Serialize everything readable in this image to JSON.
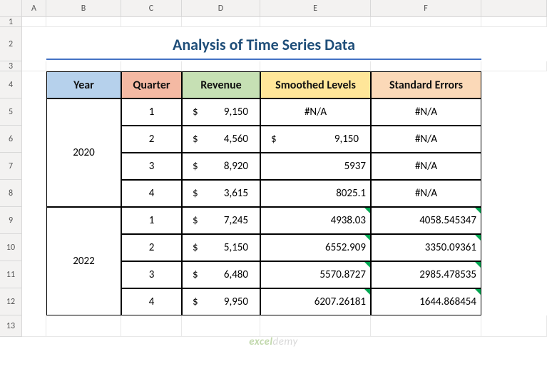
{
  "columns": [
    "A",
    "B",
    "C",
    "D",
    "E",
    "F"
  ],
  "rows": [
    "1",
    "2",
    "3",
    "4",
    "5",
    "6",
    "7",
    "8",
    "9",
    "10",
    "11",
    "12",
    "13"
  ],
  "title": "Analysis of Time Series Data",
  "headers": {
    "year": "Year",
    "quarter": "Quarter",
    "revenue": "Revenue",
    "smoothed": "Smoothed Levels",
    "std": "Standard Errors"
  },
  "years": [
    "2020",
    "2022"
  ],
  "rows_data": [
    {
      "q": "1",
      "rev": "9,150",
      "smooth": "#N/A",
      "std": "#N/A",
      "smoothCurrency": false,
      "smoothCenter": true,
      "stdCenter": true,
      "tri": false
    },
    {
      "q": "2",
      "rev": "4,560",
      "smooth": "9,150",
      "std": "#N/A",
      "smoothCurrency": true,
      "smoothCenter": false,
      "stdCenter": true,
      "tri": false
    },
    {
      "q": "3",
      "rev": "8,920",
      "smooth": "5937",
      "std": "#N/A",
      "smoothCurrency": false,
      "smoothCenter": false,
      "stdCenter": true,
      "tri": false
    },
    {
      "q": "4",
      "rev": "3,615",
      "smooth": "8025.1",
      "std": "#N/A",
      "smoothCurrency": false,
      "smoothCenter": false,
      "stdCenter": true,
      "tri": false
    },
    {
      "q": "1",
      "rev": "7,245",
      "smooth": "4938.03",
      "std": "4058.545347",
      "smoothCurrency": false,
      "smoothCenter": false,
      "stdCenter": false,
      "tri": true
    },
    {
      "q": "2",
      "rev": "5,150",
      "smooth": "6552.909",
      "std": "3350.09361",
      "smoothCurrency": false,
      "smoothCenter": false,
      "stdCenter": false,
      "tri": true
    },
    {
      "q": "3",
      "rev": "6,480",
      "smooth": "5570.8727",
      "std": "2985.478535",
      "smoothCurrency": false,
      "smoothCenter": false,
      "stdCenter": false,
      "tri": true
    },
    {
      "q": "4",
      "rev": "9,950",
      "smooth": "6207.26181",
      "std": "1644.868454",
      "smoothCurrency": false,
      "smoothCenter": false,
      "stdCenter": false,
      "tri": true
    }
  ],
  "watermark": {
    "a": "excel",
    "b": "demy"
  },
  "chart_data": {
    "type": "table",
    "title": "Analysis of Time Series Data",
    "columns": [
      "Year",
      "Quarter",
      "Revenue",
      "Smoothed Levels",
      "Standard Errors"
    ],
    "rows": [
      [
        "2020",
        "1",
        9150,
        null,
        null
      ],
      [
        "2020",
        "2",
        4560,
        9150,
        null
      ],
      [
        "2020",
        "3",
        8920,
        5937,
        null
      ],
      [
        "2020",
        "4",
        3615,
        8025.1,
        null
      ],
      [
        "2022",
        "1",
        7245,
        4938.03,
        4058.545347
      ],
      [
        "2022",
        "2",
        5150,
        6552.909,
        3350.09361
      ],
      [
        "2022",
        "3",
        6480,
        5570.8727,
        2985.478535
      ],
      [
        "2022",
        "4",
        9950,
        6207.26181,
        1644.868454
      ]
    ]
  }
}
